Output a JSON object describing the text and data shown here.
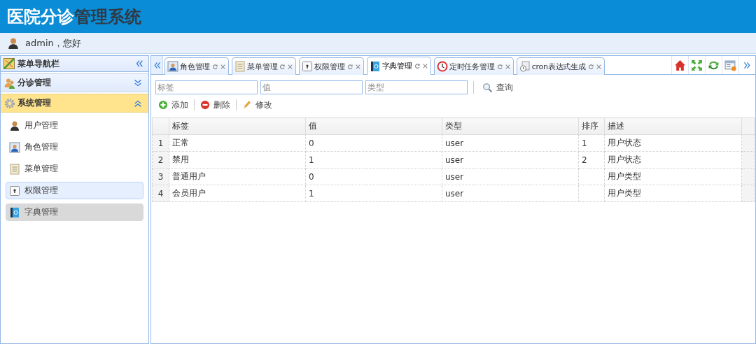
{
  "header": {
    "title": [
      {
        "text": "医院分诊",
        "kind": "light"
      },
      {
        "text": "管理系统",
        "kind": "dark"
      }
    ]
  },
  "user_bar": {
    "greeting": "admin，您好"
  },
  "sidebar": {
    "title": "菜单导航栏",
    "groups": [
      {
        "label": "分诊管理",
        "expanded": false
      },
      {
        "label": "系统管理",
        "expanded": true,
        "items": [
          {
            "label": "用户管理",
            "selected": false,
            "hovered": false
          },
          {
            "label": "角色管理",
            "selected": false,
            "hovered": false
          },
          {
            "label": "菜单管理",
            "selected": false,
            "hovered": false
          },
          {
            "label": "权限管理",
            "selected": false,
            "hovered": true
          },
          {
            "label": "字典管理",
            "selected": true,
            "hovered": false
          }
        ]
      }
    ]
  },
  "tabs": [
    {
      "label": "角色管理",
      "selected": false
    },
    {
      "label": "菜单管理",
      "selected": false
    },
    {
      "label": "权限管理",
      "selected": false
    },
    {
      "label": "字典管理",
      "selected": true
    },
    {
      "label": "定时任务管理",
      "selected": false
    },
    {
      "label": "cron表达式生成",
      "selected": false
    }
  ],
  "filters": [
    {
      "placeholder": "标签"
    },
    {
      "placeholder": "值"
    },
    {
      "placeholder": "类型"
    }
  ],
  "search_button": "查询",
  "actions": [
    {
      "label": "添加",
      "kind": "add"
    },
    {
      "label": "删除",
      "kind": "delete"
    },
    {
      "label": "修改",
      "kind": "edit"
    }
  ],
  "table": {
    "columns": [
      "标签",
      "值",
      "类型",
      "排序",
      "描述"
    ],
    "rows": [
      {
        "number": "1",
        "cells": [
          "正常",
          "0",
          "user",
          "1",
          "用户状态"
        ]
      },
      {
        "number": "2",
        "cells": [
          "禁用",
          "1",
          "user",
          "2",
          "用户状态"
        ]
      },
      {
        "number": "3",
        "cells": [
          "普通用户",
          "0",
          "user",
          null,
          "用户类型"
        ]
      },
      {
        "number": "4",
        "cells": [
          "会员用户",
          "1",
          "user",
          null,
          "用户类型"
        ]
      }
    ]
  }
}
